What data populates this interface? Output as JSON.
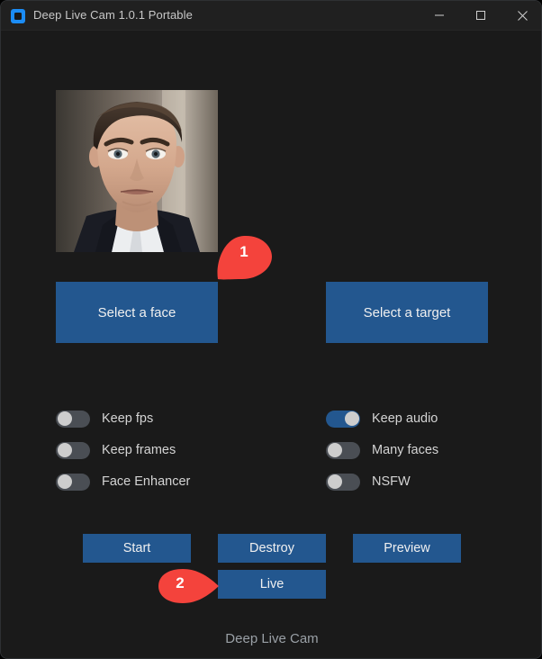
{
  "window": {
    "title": "Deep Live Cam 1.0.1 Portable",
    "app_icon": "app-logo-icon",
    "controls": {
      "minimize": "minimize-icon",
      "maximize": "maximize-icon",
      "close": "close-icon"
    }
  },
  "colors": {
    "window_bg": "#1a1a1a",
    "titlebar_bg": "#202020",
    "accent_blue": "#23578f",
    "icon_blue": "#1b8cf5",
    "switch_off": "#4a4e54",
    "switch_knob": "#cdcdcd",
    "marker_red": "#f4433c",
    "text": "#d4d4d4",
    "status_text": "#9aa0a6"
  },
  "preview": {
    "face_image_alt": "selected-face-photo"
  },
  "selectors": {
    "face_label": "Select a face",
    "target_label": "Select a target"
  },
  "switches": {
    "left": [
      {
        "label": "Keep fps",
        "on": false
      },
      {
        "label": "Keep frames",
        "on": false
      },
      {
        "label": "Face Enhancer",
        "on": false
      }
    ],
    "right": [
      {
        "label": "Keep audio",
        "on": true
      },
      {
        "label": "Many faces",
        "on": false
      },
      {
        "label": "NSFW",
        "on": false
      }
    ]
  },
  "actions": {
    "start": "Start",
    "destroy": "Destroy",
    "preview": "Preview",
    "live": "Live"
  },
  "status": {
    "text": "Deep Live Cam"
  },
  "annotations": [
    {
      "number": "1",
      "points_to": "Select a face"
    },
    {
      "number": "2",
      "points_to": "Live"
    }
  ]
}
